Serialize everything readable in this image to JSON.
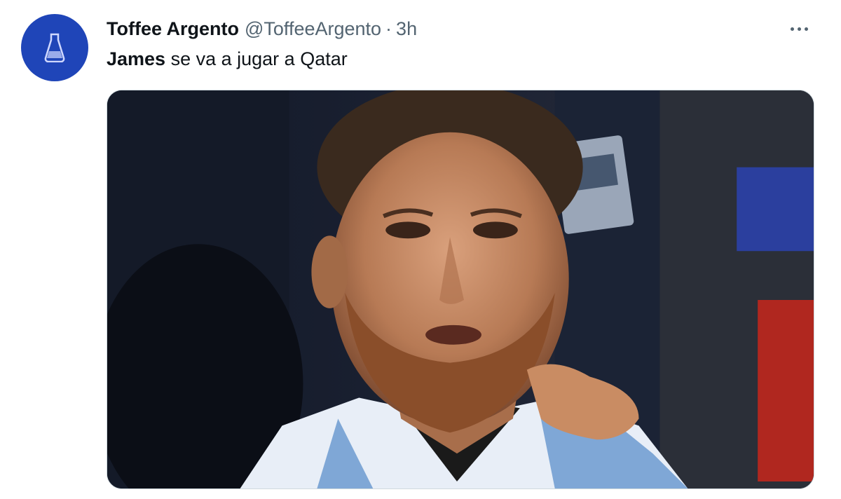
{
  "tweet": {
    "author": {
      "display_name": "Toffee Argento",
      "handle": "@ToffeeArgento",
      "avatar_color": "#1f45b8"
    },
    "separator": "·",
    "time": "3h",
    "more_icon": "more-horizontal-icon",
    "text": {
      "mention": "James",
      "rest": " se va a jugar a Qatar"
    },
    "media": {
      "kind": "photo"
    }
  }
}
